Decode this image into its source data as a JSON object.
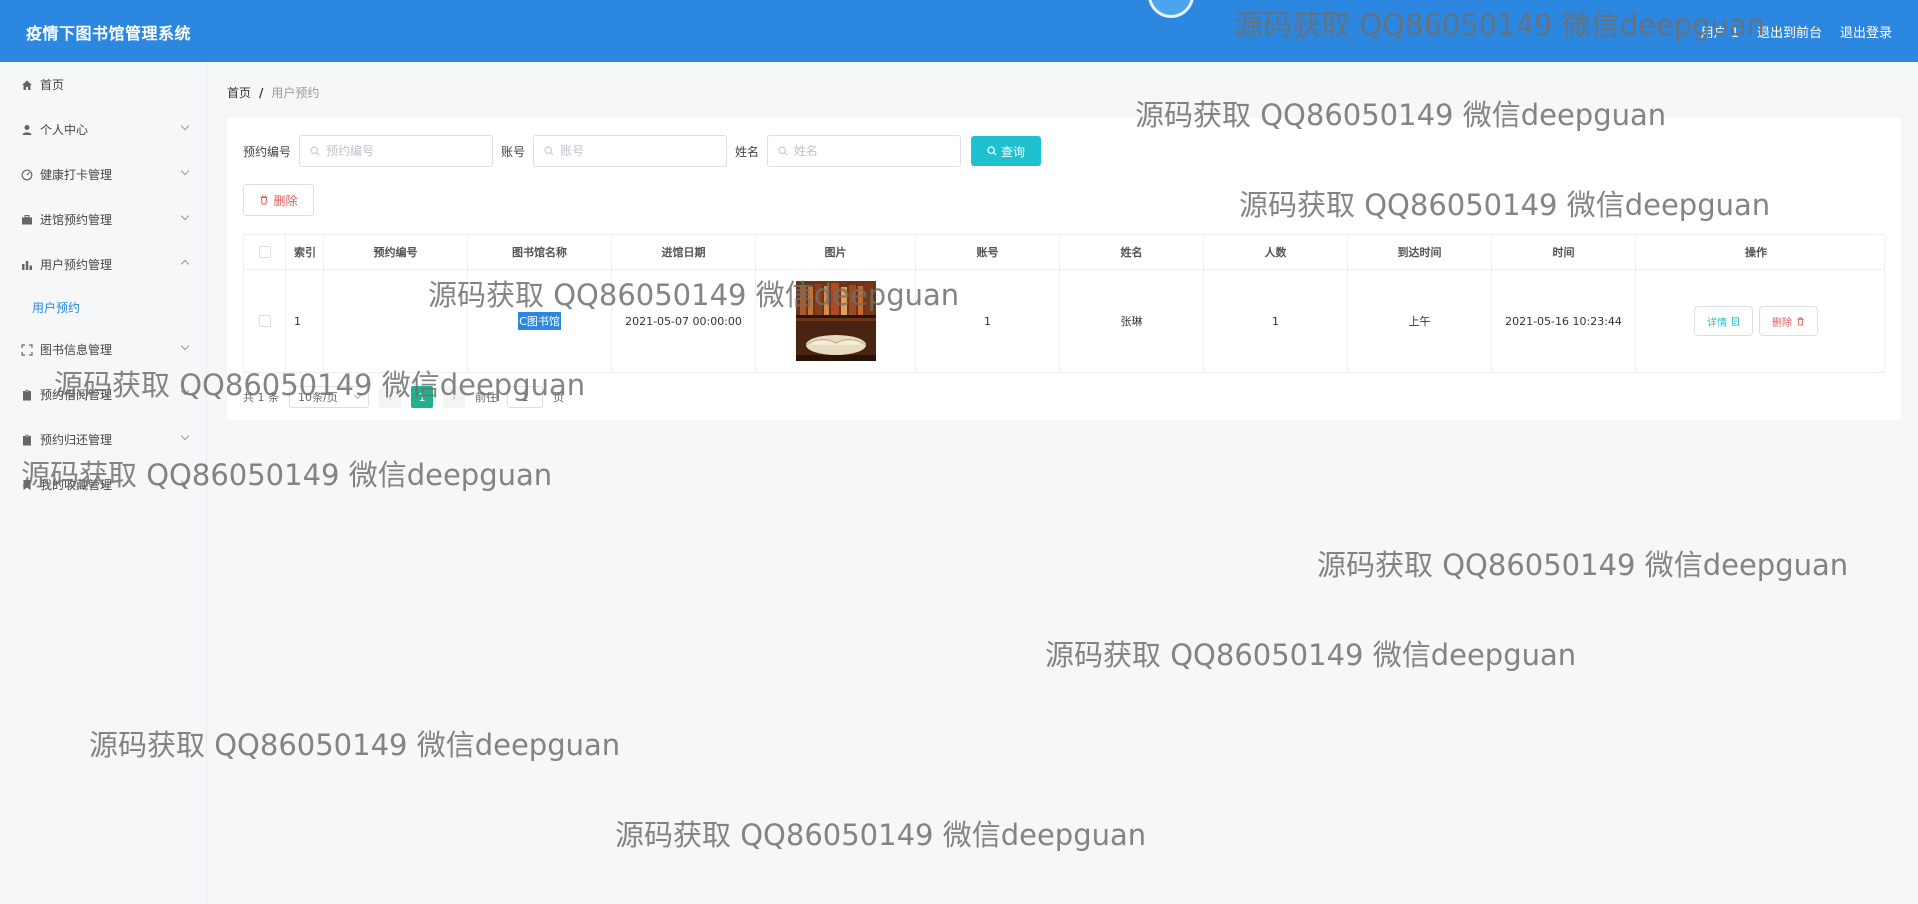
{
  "header": {
    "title": "疫情下图书馆管理系统",
    "user_label": "用户 1",
    "front_link": "退出到前台",
    "logout_link": "退出登录"
  },
  "sidebar": {
    "items": [
      {
        "label": "首页",
        "icon": "home-icon"
      },
      {
        "label": "个人中心",
        "icon": "user-icon"
      },
      {
        "label": "健康打卡管理",
        "icon": "health-icon"
      },
      {
        "label": "进馆预约管理",
        "icon": "briefcase-icon"
      },
      {
        "label": "用户预约管理",
        "icon": "bar-chart-icon"
      },
      {
        "label": "图书信息管理",
        "icon": "frame-icon"
      },
      {
        "label": "预约借阅管理",
        "icon": "clipboard-icon"
      },
      {
        "label": "预约归还管理",
        "icon": "clipboard-icon"
      },
      {
        "label": "我的收藏管理",
        "icon": "bookmark-icon"
      }
    ],
    "sub_active": "用户预约"
  },
  "breadcrumb": {
    "home": "首页",
    "separator": "/",
    "current": "用户预约"
  },
  "search": {
    "field1_label": "预约编号",
    "field1_placeholder": "预约编号",
    "field2_label": "账号",
    "field2_placeholder": "账号",
    "field3_label": "姓名",
    "field3_placeholder": "姓名",
    "query_button": "查询"
  },
  "toolbar": {
    "delete_button": "删除"
  },
  "table": {
    "columns": [
      "索引",
      "预约编号",
      "图书馆名称",
      "进馆日期",
      "图片",
      "账号",
      "姓名",
      "人数",
      "到达时间",
      "时间",
      "操作"
    ],
    "rows": [
      {
        "index": "1",
        "booking_no": "",
        "library_name": "C图书馆",
        "visit_date": "2021-05-07 00:00:00",
        "account": "1",
        "name": "张琳",
        "people": "1",
        "arrival": "上午",
        "time": "2021-05-16 10:23:44",
        "detail_btn": "详情",
        "delete_btn": "删除"
      }
    ]
  },
  "pager": {
    "total": "共 1 条",
    "page_size": "10条/页",
    "prev": "‹",
    "current_page": "1",
    "next": "›",
    "goto_label": "前往",
    "goto_value": "1",
    "goto_suffix": "页"
  },
  "watermark": "源码获取 QQ86050149 微信deepguan",
  "colors": {
    "header_bg": "#2c87e0",
    "accent_cyan": "#1fc1d0",
    "danger": "#e85a5a",
    "page_active": "#20b28f"
  }
}
